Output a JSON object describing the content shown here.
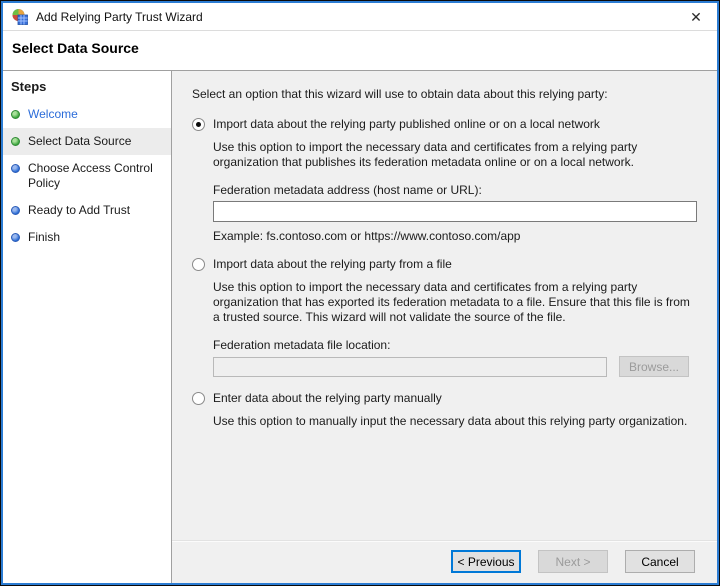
{
  "window": {
    "title": "Add Relying Party Trust Wizard",
    "close_glyph": "✕"
  },
  "header": {
    "title": "Select Data Source"
  },
  "sidebar": {
    "title": "Steps",
    "items": [
      {
        "label": "Welcome",
        "bullet": "green",
        "current": false
      },
      {
        "label": "Select Data Source",
        "bullet": "green",
        "current": true
      },
      {
        "label": "Choose Access Control Policy",
        "bullet": "blue",
        "current": false
      },
      {
        "label": "Ready to Add Trust",
        "bullet": "blue",
        "current": false
      },
      {
        "label": "Finish",
        "bullet": "blue",
        "current": false
      }
    ]
  },
  "main": {
    "intro": "Select an option that this wizard will use to obtain data about this relying party:",
    "options": [
      {
        "label": "Import data about the relying party published online or on a local network",
        "selected": true,
        "description": "Use this option to import the necessary data and certificates from a relying party organization that publishes its federation metadata online or on a local network.",
        "field_label": "Federation metadata address (host name or URL):",
        "field_value": "",
        "example": "Example: fs.contoso.com or https://www.contoso.com/app"
      },
      {
        "label": "Import data about the relying party from a file",
        "selected": false,
        "description": "Use this option to import the necessary data and certificates from a relying party organization that has exported its federation metadata to a file. Ensure that this file is from a trusted source.  This wizard will not validate the source of the file.",
        "field_label": "Federation metadata file location:",
        "field_value": "",
        "browse_label": "Browse..."
      },
      {
        "label": "Enter data about the relying party manually",
        "selected": false,
        "description": "Use this option to manually input the necessary data about this relying party organization."
      }
    ]
  },
  "footer": {
    "previous_label": "< Previous",
    "next_label": "Next >",
    "cancel_label": "Cancel"
  },
  "colors": {
    "window_border": "#2b7cd3",
    "link_blue": "#2b6cd9",
    "bullet_green": "#3fa83f",
    "bullet_blue": "#2d6ed6",
    "focus_blue": "#0078d7",
    "main_bg": "#f0f0f0",
    "step_highlight": "#ececec"
  }
}
